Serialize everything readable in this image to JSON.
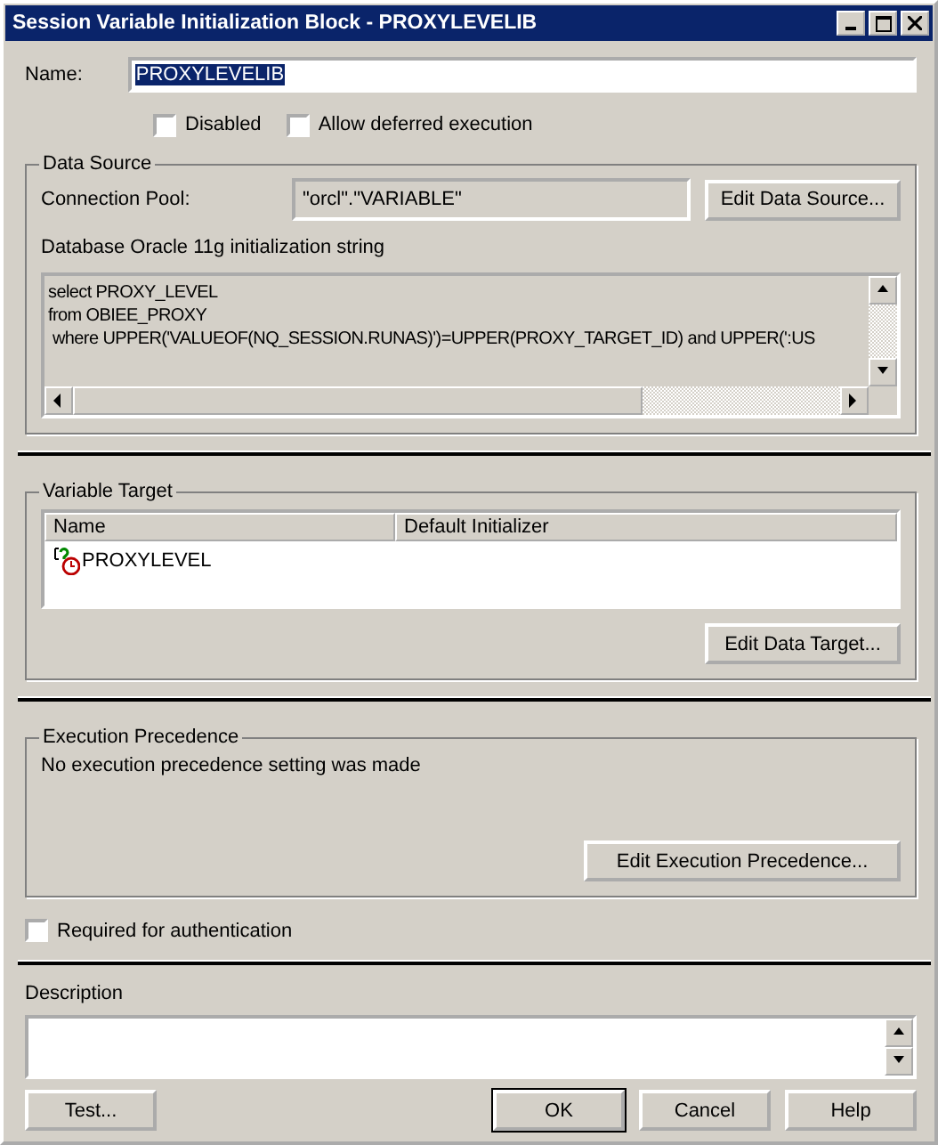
{
  "window": {
    "title": "Session Variable Initialization Block - PROXYLEVELIB"
  },
  "name_field": {
    "label": "Name:",
    "value": "PROXYLEVELIB",
    "selected": true
  },
  "options": [
    {
      "label": "Disabled",
      "checked": false
    },
    {
      "label": "Allow deferred execution",
      "checked": false
    }
  ],
  "data_source": {
    "title": "Data Source",
    "connection_pool_label": "Connection Pool:",
    "connection_pool": "\"orcl\".\"VARIABLE\"",
    "edit_button": "Edit Data Source...",
    "string_label": "Database Oracle 11g initialization string",
    "sql_lines": [
      "select PROXY_LEVEL",
      "from OBIEE_PROXY",
      " where UPPER('VALUEOF(NQ_SESSION.RUNAS)')=UPPER(PROXY_TARGET_ID) and UPPER(':US"
    ]
  },
  "variable_target": {
    "title": "Variable Target",
    "columns": [
      "Name",
      "Default Initializer"
    ],
    "rows": [
      {
        "name": "PROXYLEVEL"
      }
    ],
    "edit_button": "Edit Data Target..."
  },
  "execution_precedence": {
    "title": "Execution Precedence",
    "message": "No execution precedence setting was made",
    "edit_button": "Edit Execution Precedence..."
  },
  "required_for_auth": {
    "label": "Required for authentication",
    "checked": false
  },
  "description": {
    "label": "Description"
  },
  "buttons": [
    {
      "label": "Test...",
      "default": false
    },
    {
      "label": "OK",
      "default": true
    },
    {
      "label": "Cancel",
      "default": false
    },
    {
      "label": "Help",
      "default": false
    }
  ]
}
